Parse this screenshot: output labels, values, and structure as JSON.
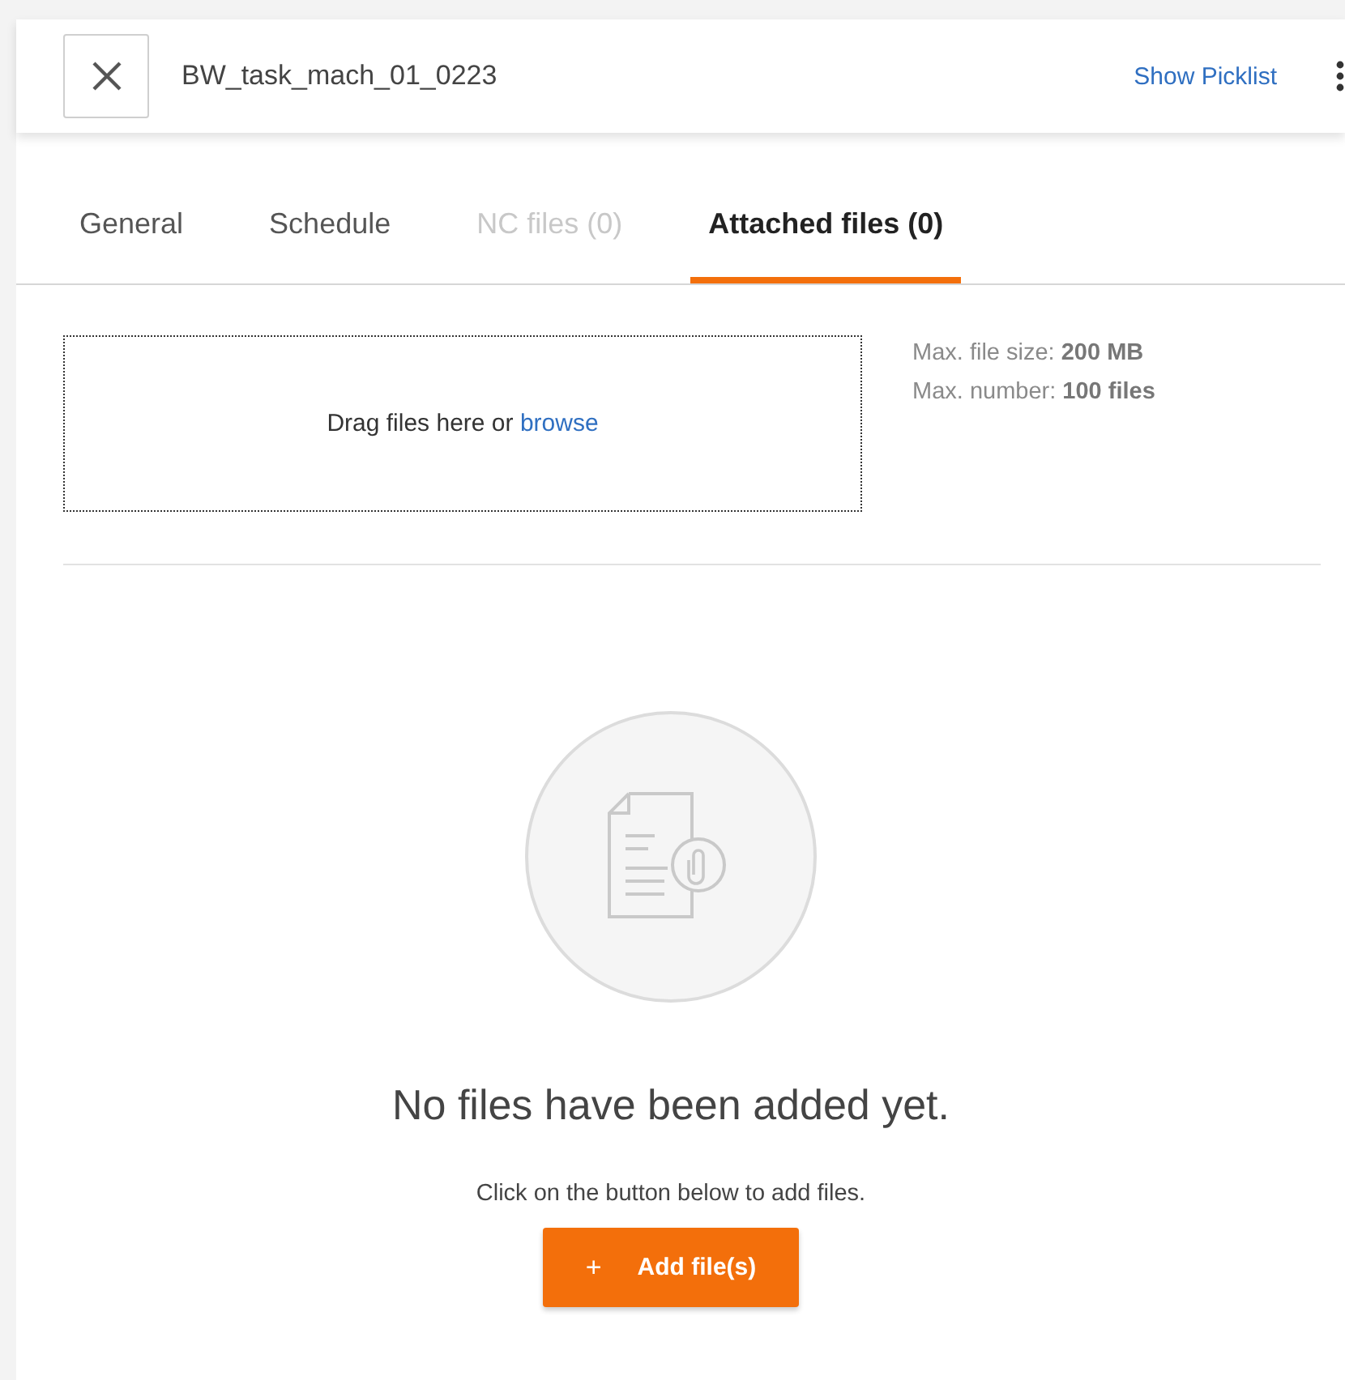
{
  "header": {
    "title": "BW_task_mach_01_0223",
    "link": "Show Picklist"
  },
  "tabs": [
    {
      "label": "General",
      "selected": false,
      "disabled": false
    },
    {
      "label": "Schedule",
      "selected": false,
      "disabled": false
    },
    {
      "label": "NC files (0)",
      "selected": false,
      "disabled": true
    },
    {
      "label": "Attached files (0)",
      "selected": true,
      "disabled": false
    }
  ],
  "dropzone": {
    "text": "Drag files here or",
    "link": "browse"
  },
  "limits": [
    "Max. file size: **200 MB**",
    "Max. number: **100 files**"
  ],
  "empty_state": {
    "heading": "No files have been added yet.",
    "hint": "Click on the button below to add files.",
    "button": {
      "icon": "+",
      "label": "Add file(s)"
    }
  }
}
